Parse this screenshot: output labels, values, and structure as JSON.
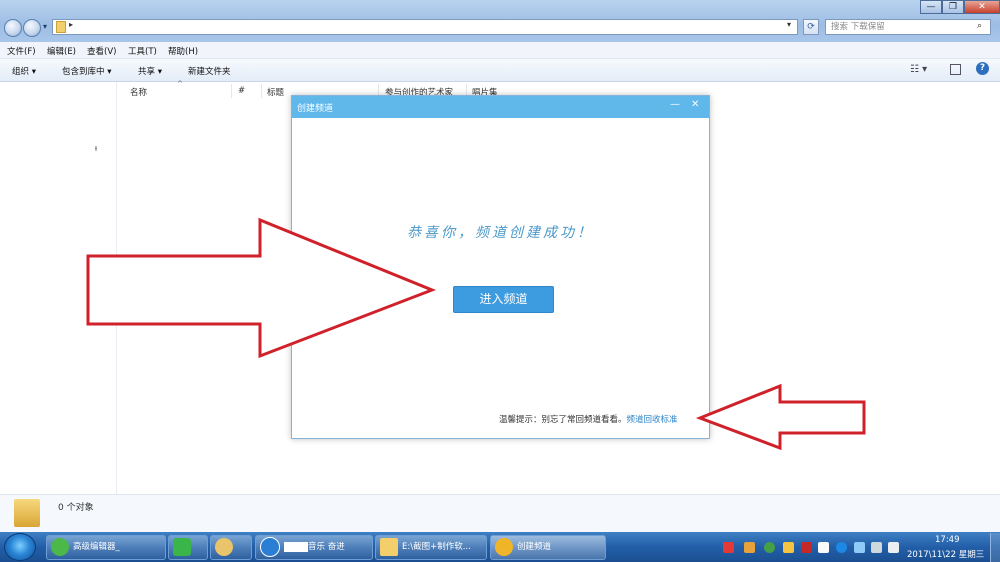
{
  "window": {
    "address_text": "▸",
    "search_placeholder": "搜索 下载保留",
    "controls": [
      "—",
      "❐",
      "✕"
    ]
  },
  "menubar": {
    "items": [
      "文件(F)",
      "编辑(E)",
      "查看(V)",
      "工具(T)",
      "帮助(H)"
    ]
  },
  "toolbar": {
    "organize": "组织 ▾",
    "include_library": "包含到库中 ▾",
    "share": "共享 ▾",
    "new_folder": "新建文件夹"
  },
  "columns": [
    "名称",
    "#",
    "标题",
    "参与创作的艺术家",
    "唱片集"
  ],
  "dialog": {
    "title": "创建频道",
    "minimize": "—",
    "close": "✕",
    "success_message": "恭喜你，频道创建成功！",
    "enter_button": "进入频道",
    "tip_prefix": "温馨提示：别忘了常回频道看看。",
    "tip_link": "频道回收标准"
  },
  "status": {
    "object_count": "0 个对象"
  },
  "taskbar": {
    "buttons": [
      {
        "label": "高级编辑器_"
      },
      {
        "label": ""
      },
      {
        "label": ""
      },
      {
        "label": "音乐 奋进"
      },
      {
        "label": "E:\\截图+制作软..."
      },
      {
        "label": "创建频道"
      }
    ],
    "time": "17:49",
    "date": "2017\\11\\22 星期三"
  },
  "colors": {
    "dialog_title_bar": "#5fb7ea",
    "button_blue": "#3d9be0",
    "link_blue": "#2f86c9",
    "arrow_red": "#d0212a",
    "taskbar_blue": "#225fa8"
  }
}
